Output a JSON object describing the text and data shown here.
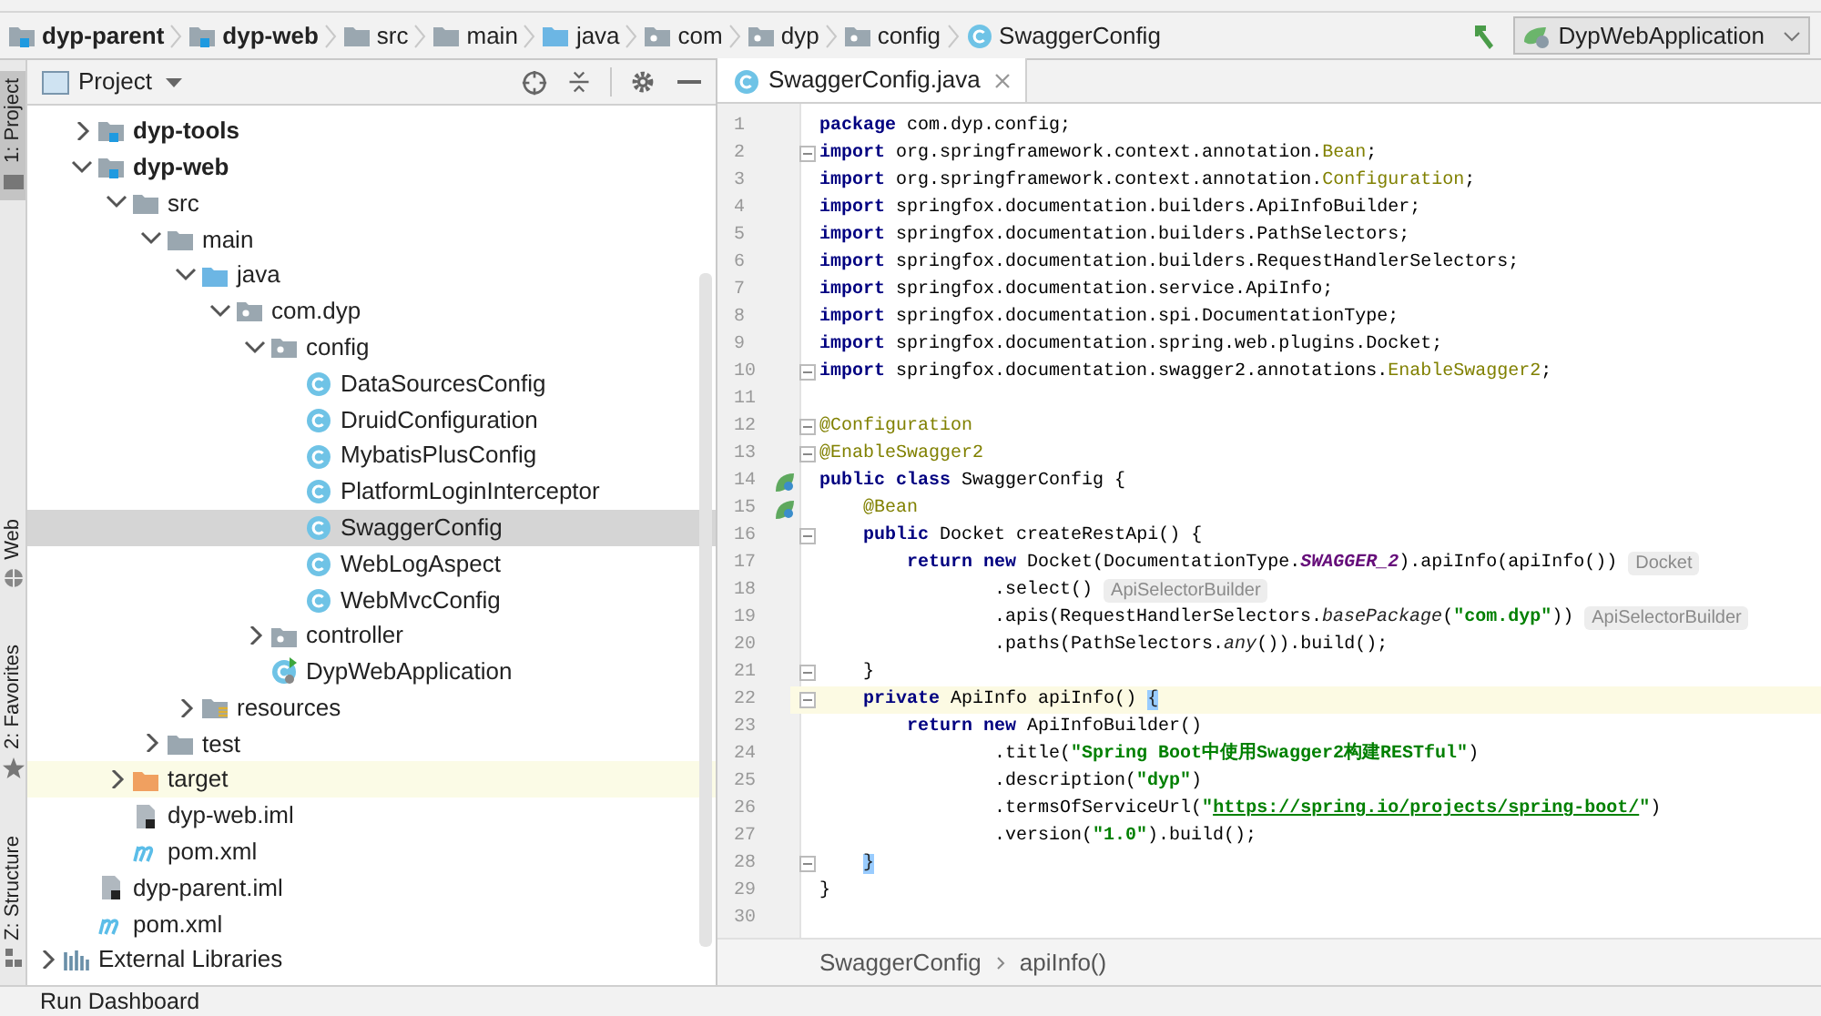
{
  "breadcrumbs": [
    {
      "label": "dyp-parent",
      "kind": "module"
    },
    {
      "label": "dyp-web",
      "kind": "module"
    },
    {
      "label": "src",
      "kind": "folder"
    },
    {
      "label": "main",
      "kind": "folder"
    },
    {
      "label": "java",
      "kind": "source-root"
    },
    {
      "label": "com",
      "kind": "package"
    },
    {
      "label": "dyp",
      "kind": "package"
    },
    {
      "label": "config",
      "kind": "package"
    },
    {
      "label": "SwaggerConfig",
      "kind": "class"
    }
  ],
  "run_config": {
    "label": "DypWebApplication"
  },
  "tool_tabs": [
    {
      "label": "1: Project",
      "kind": "project",
      "selected": true
    },
    {
      "label": "Web",
      "kind": "web",
      "selected": false
    },
    {
      "label": "2: Favorites",
      "kind": "favorites",
      "selected": false
    },
    {
      "label": "Z: Structure",
      "kind": "structure",
      "selected": false
    }
  ],
  "project": {
    "title": "Project",
    "tree": [
      {
        "children": [
          {
            "label": "dyp-tools",
            "kind": "module",
            "expanded": false,
            "selected": false
          },
          {
            "label": "dyp-web",
            "kind": "module",
            "expanded": true,
            "selected": false,
            "children": [
              {
                "label": "src",
                "kind": "folder",
                "expanded": true,
                "selected": false,
                "children": [
                  {
                    "label": "main",
                    "kind": "folder",
                    "expanded": true,
                    "selected": false,
                    "children": [
                      {
                        "label": "java",
                        "kind": "source-root",
                        "expanded": true,
                        "selected": false,
                        "children": [
                          {
                            "label": "com.dyp",
                            "kind": "package",
                            "expanded": true,
                            "selected": false,
                            "children": [
                              {
                                "label": "config",
                                "kind": "package",
                                "expanded": true,
                                "selected": false,
                                "children": [
                                  {
                                    "label": "DataSourcesConfig",
                                    "kind": "class",
                                    "selected": false
                                  },
                                  {
                                    "label": "DruidConfiguration",
                                    "kind": "class",
                                    "selected": false
                                  },
                                  {
                                    "label": "MybatisPlusConfig",
                                    "kind": "class",
                                    "selected": false
                                  },
                                  {
                                    "label": "PlatformLoginInterceptor",
                                    "kind": "class",
                                    "selected": false
                                  },
                                  {
                                    "label": "SwaggerConfig",
                                    "kind": "class",
                                    "selected": true
                                  },
                                  {
                                    "label": "WebLogAspect",
                                    "kind": "class",
                                    "selected": false
                                  },
                                  {
                                    "label": "WebMvcConfig",
                                    "kind": "class",
                                    "selected": false
                                  }
                                ]
                              },
                              {
                                "label": "controller",
                                "kind": "package",
                                "expanded": false,
                                "selected": false
                              },
                              {
                                "label": "DypWebApplication",
                                "kind": "app",
                                "selected": false
                              }
                            ]
                          }
                        ]
                      },
                      {
                        "label": "resources",
                        "kind": "resources",
                        "expanded": false,
                        "selected": false
                      }
                    ]
                  },
                  {
                    "label": "test",
                    "kind": "folder",
                    "expanded": false,
                    "selected": false
                  }
                ]
              },
              {
                "label": "target",
                "kind": "excluded",
                "expanded": false,
                "selected": false
              },
              {
                "label": "dyp-web.iml",
                "kind": "iml",
                "selected": false
              },
              {
                "label": "pom.xml",
                "kind": "maven",
                "selected": false
              }
            ]
          },
          {
            "label": "dyp-parent.iml",
            "kind": "iml",
            "selected": false
          },
          {
            "label": "pom.xml",
            "kind": "maven",
            "selected": false
          }
        ]
      },
      {
        "label": "External Libraries",
        "kind": "libraries",
        "expanded": false,
        "selected": false
      }
    ]
  },
  "editor": {
    "tabs": [
      {
        "label": "SwaggerConfig.java",
        "selected": true
      }
    ],
    "lines": [
      {
        "n": "1",
        "tokens": [
          {
            "kind": "keyword",
            "text": "package"
          },
          {
            "kind": "plain",
            "text": " com.dyp.config;"
          }
        ]
      },
      {
        "n": "2",
        "fold": true,
        "tokens": [
          {
            "kind": "keyword",
            "text": "import"
          },
          {
            "kind": "plain",
            "text": " org.springframework.context.annotation."
          },
          {
            "kind": "annotation",
            "text": "Bean"
          },
          {
            "kind": "plain",
            "text": ";"
          }
        ]
      },
      {
        "n": "3",
        "tokens": [
          {
            "kind": "keyword",
            "text": "import"
          },
          {
            "kind": "plain",
            "text": " org.springframework.context.annotation."
          },
          {
            "kind": "annotation",
            "text": "Configuration"
          },
          {
            "kind": "plain",
            "text": ";"
          }
        ]
      },
      {
        "n": "4",
        "tokens": [
          {
            "kind": "keyword",
            "text": "import"
          },
          {
            "kind": "plain",
            "text": " springfox.documentation.builders.ApiInfoBuilder;"
          }
        ]
      },
      {
        "n": "5",
        "tokens": [
          {
            "kind": "keyword",
            "text": "import"
          },
          {
            "kind": "plain",
            "text": " springfox.documentation.builders.PathSelectors;"
          }
        ]
      },
      {
        "n": "6",
        "tokens": [
          {
            "kind": "keyword",
            "text": "import"
          },
          {
            "kind": "plain",
            "text": " springfox.documentation.builders.RequestHandlerSelectors;"
          }
        ]
      },
      {
        "n": "7",
        "tokens": [
          {
            "kind": "keyword",
            "text": "import"
          },
          {
            "kind": "plain",
            "text": " springfox.documentation.service.ApiInfo;"
          }
        ]
      },
      {
        "n": "8",
        "tokens": [
          {
            "kind": "keyword",
            "text": "import"
          },
          {
            "kind": "plain",
            "text": " springfox.documentation.spi.DocumentationType;"
          }
        ]
      },
      {
        "n": "9",
        "tokens": [
          {
            "kind": "keyword",
            "text": "import"
          },
          {
            "kind": "plain",
            "text": " springfox.documentation.spring.web.plugins.Docket;"
          }
        ]
      },
      {
        "n": "10",
        "fold": true,
        "tokens": [
          {
            "kind": "keyword",
            "text": "import"
          },
          {
            "kind": "plain",
            "text": " springfox.documentation.swagger2.annotations."
          },
          {
            "kind": "annotation",
            "text": "EnableSwagger2"
          },
          {
            "kind": "plain",
            "text": ";"
          }
        ]
      },
      {
        "n": "11"
      },
      {
        "n": "12",
        "fold": true,
        "tokens": [
          {
            "kind": "annotation",
            "text": "@Configuration"
          }
        ]
      },
      {
        "n": "13",
        "fold": true,
        "tokens": [
          {
            "kind": "annotation",
            "text": "@EnableSwagger2"
          }
        ]
      },
      {
        "n": "14",
        "bean_marker": true,
        "tokens": [
          {
            "kind": "keyword",
            "text": "public class"
          },
          {
            "kind": "plain",
            "text": " SwaggerConfig {"
          }
        ]
      },
      {
        "n": "15",
        "bean_marker": true,
        "tokens": [
          {
            "kind": "annotation",
            "text": "    @Bean"
          }
        ]
      },
      {
        "n": "16",
        "fold": true,
        "tokens": [
          {
            "kind": "keyword",
            "text": "    public"
          },
          {
            "kind": "plain",
            "text": " Docket createRestApi() {"
          }
        ]
      },
      {
        "n": "17",
        "tokens": [
          {
            "kind": "keyword",
            "text": "        return new"
          },
          {
            "kind": "plain",
            "text": " Docket(DocumentationType."
          },
          {
            "kind": "static",
            "text": "SWAGGER_2"
          },
          {
            "kind": "plain",
            "text": ").apiInfo(apiInfo())"
          }
        ],
        "hint": "Docket"
      },
      {
        "n": "18",
        "tokens": [
          {
            "kind": "plain",
            "text": "                .select()"
          }
        ],
        "hint": "ApiSelectorBuilder"
      },
      {
        "n": "19",
        "tokens": [
          {
            "kind": "plain",
            "text": "                .apis(RequestHandlerSelectors."
          },
          {
            "kind": "italic",
            "text": "basePackage"
          },
          {
            "kind": "plain",
            "text": "("
          },
          {
            "kind": "string",
            "text": "\"com.dyp\""
          },
          {
            "kind": "plain",
            "text": "))"
          }
        ],
        "hint": "ApiSelectorBuilder"
      },
      {
        "n": "20",
        "tokens": [
          {
            "kind": "plain",
            "text": "                .paths(PathSelectors."
          },
          {
            "kind": "italic",
            "text": "any"
          },
          {
            "kind": "plain",
            "text": "()).build();"
          }
        ]
      },
      {
        "n": "21",
        "fold": true,
        "tokens": [
          {
            "kind": "plain",
            "text": "    }"
          }
        ]
      },
      {
        "n": "22",
        "fold": true,
        "current": true,
        "tokens": [
          {
            "kind": "keyword",
            "text": "    private"
          },
          {
            "kind": "plain",
            "text": " ApiInfo apiInfo() "
          },
          {
            "kind": "brace",
            "text": "{"
          }
        ]
      },
      {
        "n": "23",
        "tokens": [
          {
            "kind": "keyword",
            "text": "        return new"
          },
          {
            "kind": "plain",
            "text": " ApiInfoBuilder()"
          }
        ]
      },
      {
        "n": "24",
        "tokens": [
          {
            "kind": "plain",
            "text": "                .title("
          },
          {
            "kind": "string",
            "text": "\"Spring Boot中使用Swagger2构建RESTful\""
          },
          {
            "kind": "plain",
            "text": ")"
          }
        ]
      },
      {
        "n": "25",
        "tokens": [
          {
            "kind": "plain",
            "text": "                .description("
          },
          {
            "kind": "string",
            "text": "\"dyp\""
          },
          {
            "kind": "plain",
            "text": ")"
          }
        ]
      },
      {
        "n": "26",
        "tokens": [
          {
            "kind": "plain",
            "text": "                .termsOfServiceUrl("
          },
          {
            "kind": "string",
            "text": "\""
          },
          {
            "kind": "link",
            "text": "https://spring.io/projects/spring-boot/"
          },
          {
            "kind": "string",
            "text": "\""
          },
          {
            "kind": "plain",
            "text": ")"
          }
        ]
      },
      {
        "n": "27",
        "tokens": [
          {
            "kind": "plain",
            "text": "                .version("
          },
          {
            "kind": "string",
            "text": "\"1.0\""
          },
          {
            "kind": "plain",
            "text": ").build();"
          }
        ]
      },
      {
        "n": "28",
        "fold": true,
        "tokens": [
          {
            "kind": "brace",
            "text": "    }"
          }
        ]
      },
      {
        "n": "29",
        "tokens": [
          {
            "kind": "plain",
            "text": "}"
          }
        ]
      },
      {
        "n": "30"
      }
    ],
    "breadcrumbs": [
      "SwaggerConfig",
      "apiInfo()"
    ]
  },
  "status_bar": {
    "tool_window": "Run Dashboard"
  }
}
